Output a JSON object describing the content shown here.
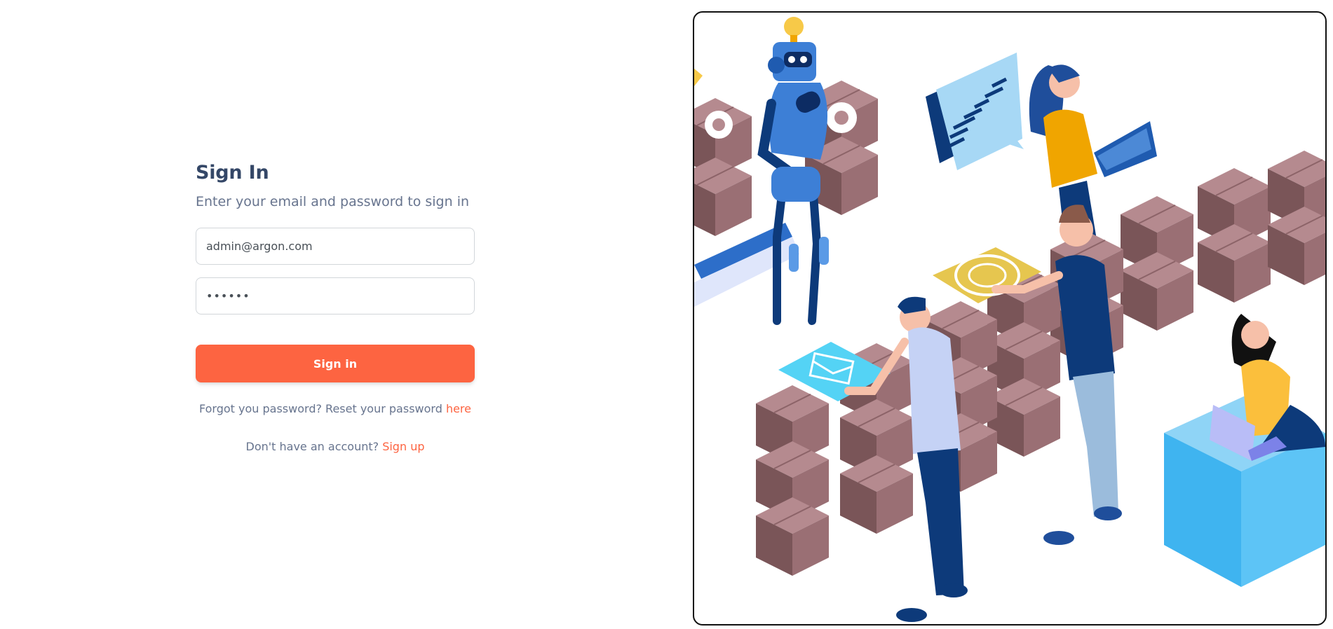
{
  "signin": {
    "title": "Sign In",
    "subtitle": "Enter your email and password to sign in",
    "email_value": "admin@argon.com",
    "password_masked": "••••••",
    "button_label": "Sign in",
    "forgot_prefix": "Forgot you password? Reset your password ",
    "forgot_link": "here",
    "signup_prefix": "Don't have an account? ",
    "signup_link": "Sign up"
  },
  "colors": {
    "accent": "#fd6441",
    "heading": "#344767",
    "muted_text": "#67748e",
    "box_dark": "#7a5558",
    "box_light": "#b58a8f",
    "robot_blue": "#3d7fd6",
    "cube_blue": "#3fb4f0"
  },
  "illustration": {
    "icons": [
      "robot-icon",
      "lightbulb-icon",
      "gear-icon",
      "chart-bubble-icon",
      "laptop-icon",
      "envelope-icon",
      "coin-icon",
      "person-icon",
      "box-stack-icon"
    ]
  }
}
